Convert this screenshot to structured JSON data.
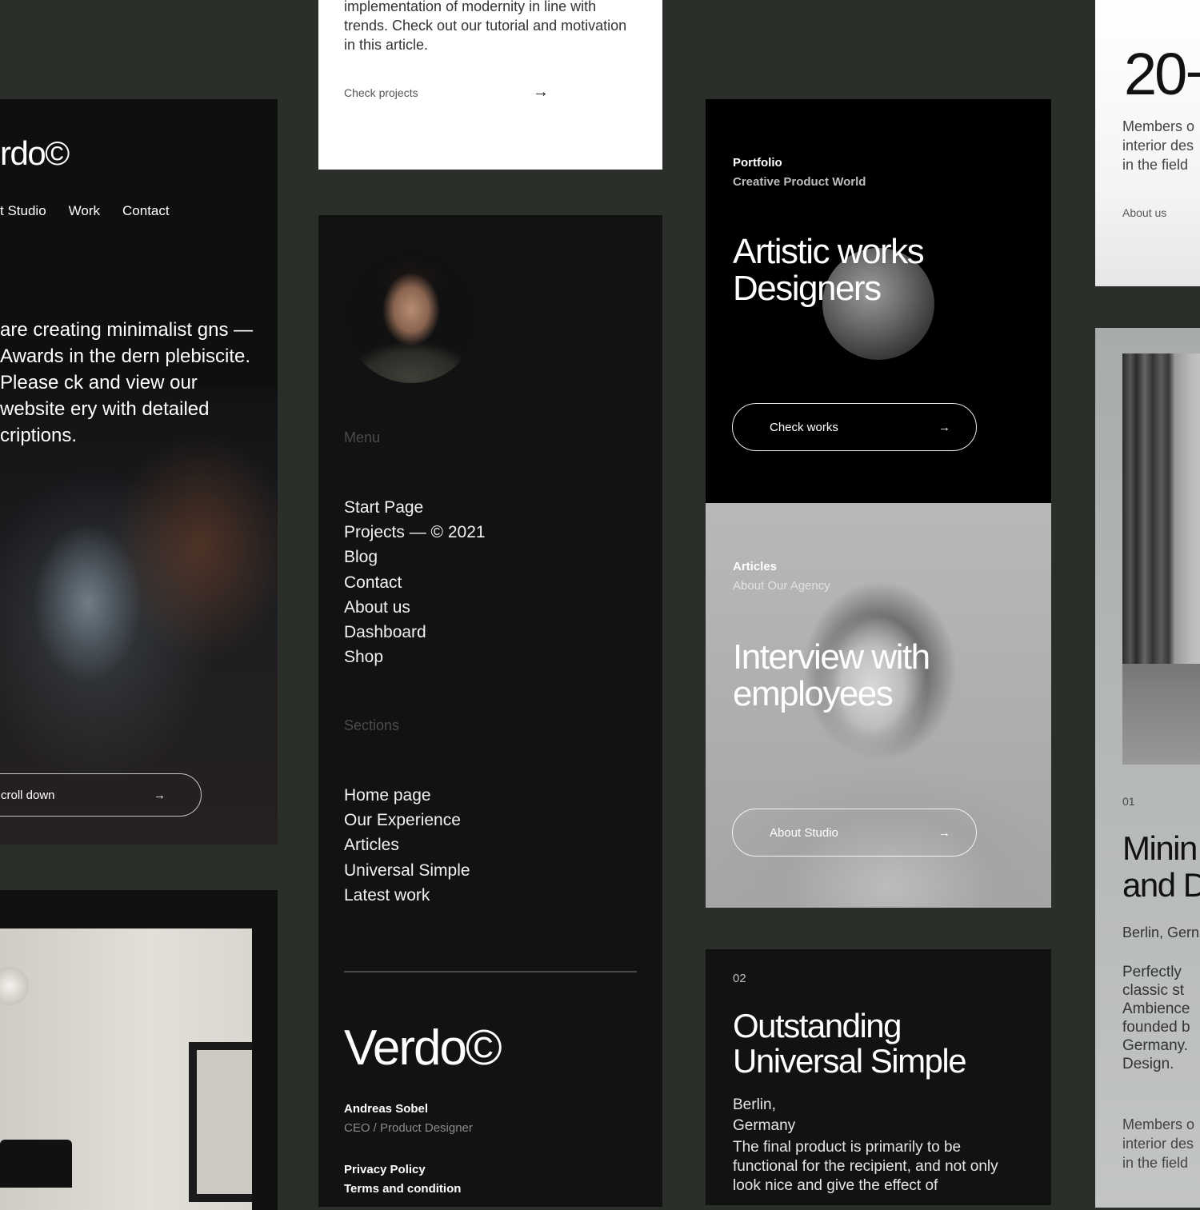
{
  "hero": {
    "logo": "rdo©",
    "nav": [
      "t Studio",
      "Work",
      "Contact"
    ],
    "intro": "are creating minimalist gns — Awards in the dern plebiscite. Please ck and view our website ery with detailed criptions.",
    "scroll_label": "croll down",
    "arrow": "→"
  },
  "article": {
    "text": "implementation of modernity in line with trends. Check out our tutorial and motivation in this article.",
    "link": "Check projects",
    "arrow": "→"
  },
  "menu": {
    "menu_heading": "Menu",
    "menu_items": [
      "Start Page",
      "Projects — © 2021",
      "Blog",
      "Contact",
      "About us",
      "Dashboard",
      "Shop"
    ],
    "sections_heading": "Sections",
    "section_items": [
      "Home page",
      "Our Experience",
      "Articles",
      "Universal Simple",
      "Latest work"
    ],
    "brand": "Verdo©",
    "person_name": "Andreas Sobel",
    "person_role": "CEO / Product Designer",
    "legal": [
      "Privacy Policy",
      "Terms and condition"
    ]
  },
  "portfolio": {
    "kicker": "Portfolio",
    "sub": "Creative Product World",
    "title_line1": "Artistic works",
    "title_line2": "Designers",
    "button": "Check works",
    "arrow": "→"
  },
  "interview": {
    "kicker": "Articles",
    "sub": "About Our Agency",
    "title_line1": "Interview with",
    "title_line2": "employees",
    "button": "About Studio",
    "arrow": "→"
  },
  "outstanding": {
    "num": "02",
    "title_line1": "Outstanding",
    "title_line2": "Universal Simple",
    "place_line1": "Berlin,",
    "place_line2": "Germany",
    "body": "The final product is primarily to be functional for the recipient, and not only look nice and give the effect of"
  },
  "stats": {
    "big": "20+",
    "text_lines": [
      "Members o",
      "interior des",
      "in the field"
    ],
    "link": "About us"
  },
  "mining": {
    "num": "01",
    "title_line1": "Minin",
    "title_line2": "and D",
    "place": "Berlin, Gern",
    "body_lines": [
      "Perfectly",
      "classic st",
      "Ambience",
      "founded b",
      "Germany.",
      "Design."
    ],
    "foot_lines": [
      "Members o",
      "interior des",
      "in the field"
    ]
  }
}
